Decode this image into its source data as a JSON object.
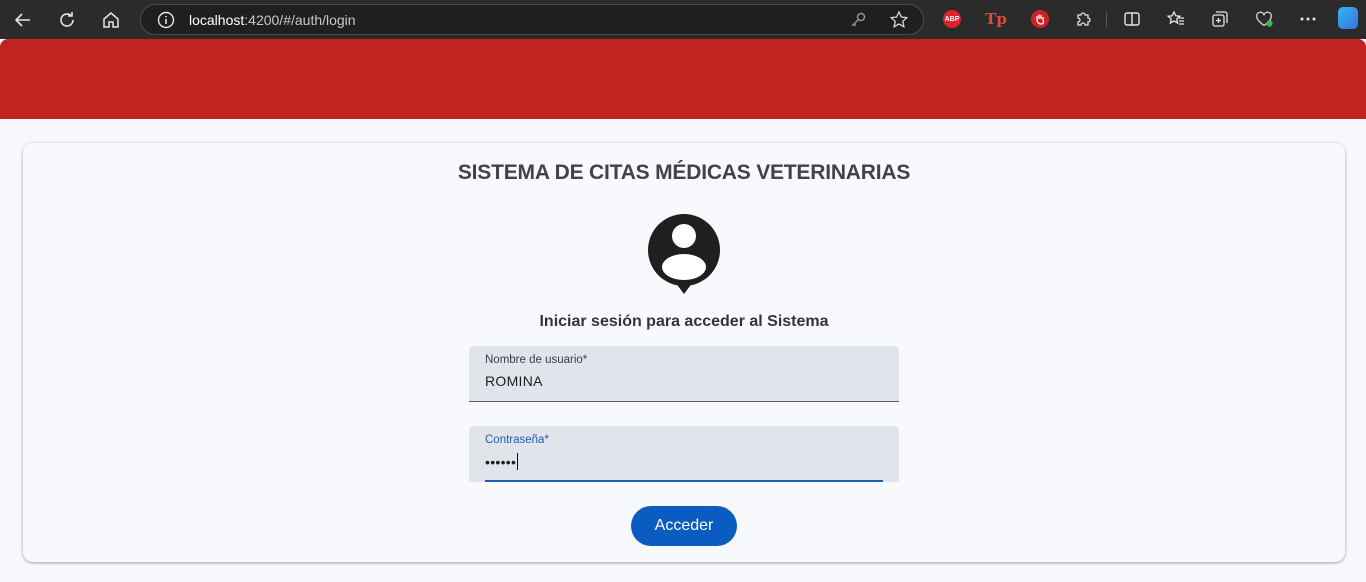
{
  "browser": {
    "url_host": "localhost",
    "url_rest": ":4200/#/auth/login",
    "extensions": {
      "abp_label": "ABP",
      "tp_label": "Tp"
    }
  },
  "login": {
    "title": "SISTEMA DE CITAS MÉDICAS VETERINARIAS",
    "subtitle": "Iniciar sesión para acceder al Sistema",
    "username_label": "Nombre de usuario*",
    "username_value": "ROMINA",
    "password_label": "Contraseña*",
    "password_value": "••••••",
    "submit_label": "Acceder"
  },
  "colors": {
    "header_red": "#c0241f",
    "primary_blue": "#0a5cc0"
  }
}
